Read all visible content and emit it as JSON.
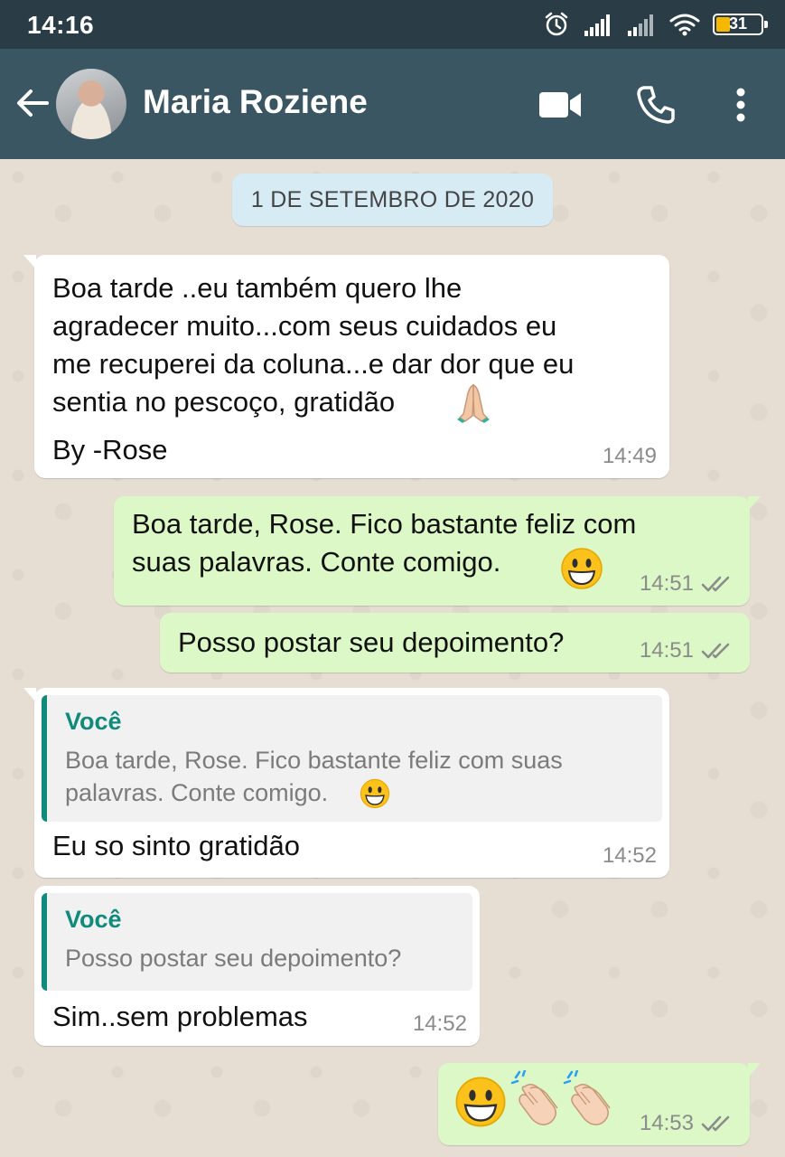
{
  "status_bar": {
    "time": "14:16",
    "battery": "31",
    "battery_level_percent": 31,
    "icons": [
      "alarm-icon",
      "signal-icon",
      "signal-icon",
      "wifi-icon",
      "battery-icon"
    ]
  },
  "header": {
    "contact_name": "Maria Roziene",
    "icons": [
      "back-arrow-icon",
      "video-call-icon",
      "phone-icon",
      "more-options-icon"
    ]
  },
  "chat": {
    "date_chip": "1 DE SETEMBRO DE 2020",
    "messages": [
      {
        "direction": "in",
        "text": "Boa tarde ..eu também quero lhe\nagradecer muito...com seus cuidados  eu\nme recuperei da coluna...e dar dor que eu\nsentia no pescoço, gratidão",
        "emoji": "folded-hands-icon",
        "signature": "By -Rose",
        "time": "14:49"
      },
      {
        "direction": "out",
        "text": "Boa tarde, Rose. Fico bastante feliz com\nsuas palavras. Conte comigo.",
        "emoji": "grinning-face-icon",
        "time": "14:51",
        "status": "double-check-icon"
      },
      {
        "direction": "out",
        "text": "Posso postar seu depoimento?",
        "time": "14:51",
        "status": "double-check-icon"
      },
      {
        "direction": "in",
        "quote": {
          "author": "Você",
          "text": "Boa tarde, Rose. Fico bastante feliz com suas\npalavras. Conte comigo."
        },
        "text": "Eu so sinto gratidão",
        "time": "14:52"
      },
      {
        "direction": "in",
        "quote": {
          "author": "Você",
          "text": "Posso postar seu depoimento?"
        },
        "text": "Sim..sem problemas",
        "time": "14:52"
      },
      {
        "direction": "out",
        "emojis": [
          "grinning-face-icon",
          "clapping-hands-icon",
          "clapping-hands-icon"
        ],
        "time": "14:53",
        "status": "double-check-icon"
      }
    ]
  },
  "colors": {
    "status_bar": "#2a3d46",
    "app_bar": "#3a5662",
    "incoming_bubble": "#ffffff",
    "outgoing_bubble": "#dcf8c6",
    "quote_accent": "#0f8a7b",
    "date_chip": "#d6ebf3",
    "read_ticks": "#8b8b8b"
  }
}
